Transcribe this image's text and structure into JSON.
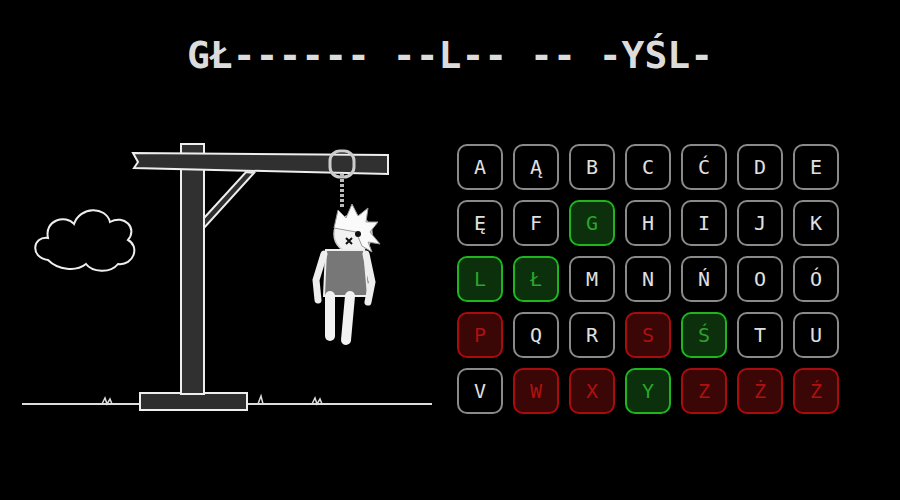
{
  "puzzle": "GŁ------ --L-- -- -YŚL-",
  "mistakes": 7,
  "keys": [
    {
      "label": "A",
      "state": "unused"
    },
    {
      "label": "Ą",
      "state": "unused"
    },
    {
      "label": "B",
      "state": "unused"
    },
    {
      "label": "C",
      "state": "unused"
    },
    {
      "label": "Ć",
      "state": "unused"
    },
    {
      "label": "D",
      "state": "unused"
    },
    {
      "label": "E",
      "state": "unused"
    },
    {
      "label": "Ę",
      "state": "unused"
    },
    {
      "label": "F",
      "state": "unused"
    },
    {
      "label": "G",
      "state": "correct"
    },
    {
      "label": "H",
      "state": "unused"
    },
    {
      "label": "I",
      "state": "unused"
    },
    {
      "label": "J",
      "state": "unused"
    },
    {
      "label": "K",
      "state": "unused"
    },
    {
      "label": "L",
      "state": "correct"
    },
    {
      "label": "Ł",
      "state": "correct"
    },
    {
      "label": "M",
      "state": "unused"
    },
    {
      "label": "N",
      "state": "unused"
    },
    {
      "label": "Ń",
      "state": "unused"
    },
    {
      "label": "O",
      "state": "unused"
    },
    {
      "label": "Ó",
      "state": "unused"
    },
    {
      "label": "P",
      "state": "wrong"
    },
    {
      "label": "Q",
      "state": "unused"
    },
    {
      "label": "R",
      "state": "unused"
    },
    {
      "label": "S",
      "state": "wrong"
    },
    {
      "label": "Ś",
      "state": "correct"
    },
    {
      "label": "T",
      "state": "unused"
    },
    {
      "label": "U",
      "state": "unused"
    },
    {
      "label": "V",
      "state": "unused"
    },
    {
      "label": "W",
      "state": "wrong"
    },
    {
      "label": "X",
      "state": "wrong"
    },
    {
      "label": "Y",
      "state": "correct"
    },
    {
      "label": "Z",
      "state": "wrong"
    },
    {
      "label": "Ż",
      "state": "wrong"
    },
    {
      "label": "Ź",
      "state": "wrong"
    }
  ]
}
